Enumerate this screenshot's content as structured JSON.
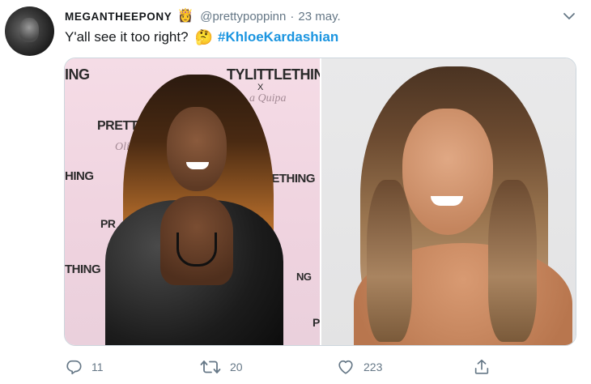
{
  "tweet": {
    "display_name": "MEGANTHEEPONY",
    "name_emoji": "👸",
    "handle": "@prettypoppinn",
    "separator": "·",
    "time": "23 may.",
    "text": "Y'all see it too right?",
    "text_emoji": "🤔",
    "hashtag": "#KhloeKardashian",
    "hashtag_color": "#1b95e0",
    "secondary_text_color": "#657786"
  },
  "media": {
    "left_photo": {
      "background_text": [
        "ING",
        "TYLITTLETHING",
        "X",
        "a Quipa",
        "PRETTYLITTL",
        "X",
        "Olivia Q",
        "HING",
        "TLETHING",
        "PR",
        "THING",
        "NG",
        "P"
      ]
    },
    "right_photo": {}
  },
  "actions": {
    "reply": {
      "icon": "reply-icon",
      "count": "11"
    },
    "retweet": {
      "icon": "retweet-icon",
      "count": "20"
    },
    "like": {
      "icon": "heart-icon",
      "count": "223"
    },
    "share": {
      "icon": "share-icon"
    }
  }
}
